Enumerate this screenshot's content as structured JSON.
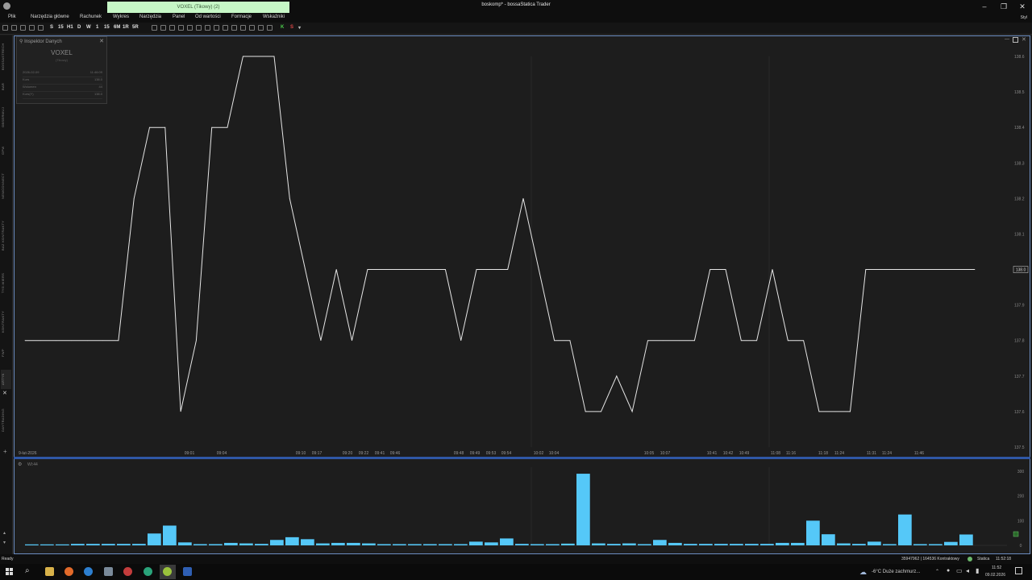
{
  "window": {
    "title": "boskomp* - bossaStatica Trader",
    "active_tab": "VOXEL (Tikowy) (2)",
    "style_label": "Styl"
  },
  "menu": [
    "Plik",
    "Narzędzia główne",
    "Rachunek",
    "Wykres",
    "Narzędzia",
    "Panel",
    "Od wartości",
    "Formacje",
    "Wskaźniki"
  ],
  "toolbar": {
    "intervals": [
      "S",
      "15",
      "H1",
      "D",
      "W",
      "1",
      "15",
      "6M",
      "1R",
      "5R"
    ],
    "k_label": "K",
    "s_label": "S"
  },
  "left_rail": [
    "BOSSASTRECH",
    "BAR",
    "OBSERWUJ",
    "GPW",
    "NEWCONNECT",
    "BAZ KONTRAKTY",
    "TYG.WIERS",
    "KONTRAKTY",
    "FWP",
    "ARTYK",
    "DAYTRADING"
  ],
  "inspector": {
    "title": "Inspektor Danych",
    "symbol": "VOXEL",
    "subtitle": "(Tikowy)",
    "rows": [
      {
        "key": "2026-02-09",
        "value": "11:46:09"
      },
      {
        "key": "Kurs",
        "value": "138.0"
      },
      {
        "key": "Wolumen",
        "value": "44"
      },
      {
        "key": "Kurs(Y)",
        "value": "138.0"
      }
    ]
  },
  "chart_data": [
    {
      "type": "line",
      "pane": "price",
      "ylim": [
        137.5,
        138.6
      ],
      "y_ticks": [
        "138.6",
        "138.5",
        "138.4",
        "138.3",
        "138.2",
        "138.1",
        "137.9",
        "137.8",
        "137.7",
        "137.6",
        "137.5"
      ],
      "current_price_label": "138.0",
      "x_date_label": "9-lut-2026",
      "x_time_labels": [
        "09:01",
        "09:04",
        "09:10",
        "09:17",
        "09:20",
        "09:22",
        "09:41",
        "09:46",
        "09:48",
        "09:49",
        "09:53",
        "09:54",
        "10:02",
        "10:04",
        "10:05",
        "10:07",
        "10:41",
        "10:42",
        "10:49",
        "11:08",
        "11:16",
        "11:18",
        "11:24",
        "11:31",
        "11:24",
        "11:46"
      ],
      "values": [
        137.8,
        137.8,
        137.8,
        137.8,
        137.8,
        137.8,
        137.8,
        138.2,
        138.4,
        138.4,
        137.6,
        137.8,
        138.4,
        138.4,
        138.6,
        138.6,
        138.6,
        138.2,
        138.0,
        137.8,
        138.0,
        137.8,
        138.0,
        138.0,
        138.0,
        138.0,
        138.0,
        138.0,
        137.8,
        138.0,
        138.0,
        138.0,
        138.2,
        138.0,
        137.8,
        137.8,
        137.6,
        137.6,
        137.7,
        137.6,
        137.8,
        137.8,
        137.8,
        137.8,
        138.0,
        138.0,
        137.8,
        137.8,
        138.0,
        137.8,
        137.8,
        137.6,
        137.6,
        137.6,
        138.0,
        138.0,
        138.0,
        138.0,
        138.0,
        138.0,
        138.0,
        138.0
      ]
    },
    {
      "type": "bar",
      "pane": "volume",
      "label": "Wl:44",
      "ylim": [
        0,
        300
      ],
      "y_ticks": [
        "300",
        "200",
        "100",
        "0"
      ],
      "values": [
        4,
        4,
        4,
        6,
        6,
        6,
        6,
        6,
        48,
        80,
        12,
        5,
        5,
        10,
        8,
        6,
        22,
        33,
        25,
        8,
        10,
        10,
        8,
        5,
        5,
        5,
        5,
        5,
        5,
        15,
        12,
        28,
        6,
        5,
        5,
        7,
        290,
        8,
        6,
        8,
        5,
        22,
        10,
        6,
        6,
        6,
        6,
        6,
        6,
        10,
        10,
        100,
        45,
        8,
        6,
        15,
        5,
        125,
        5,
        5,
        14,
        44
      ]
    }
  ],
  "statusbar": {
    "left": "Ready",
    "counter": "35947962 | 164536 Kontraktowy",
    "server": "Statica",
    "clock": "11:52:18"
  },
  "taskbar": {
    "weather": "-6°C  Duże zachmurz...",
    "time": "11:52",
    "date": "09.02.2026"
  }
}
